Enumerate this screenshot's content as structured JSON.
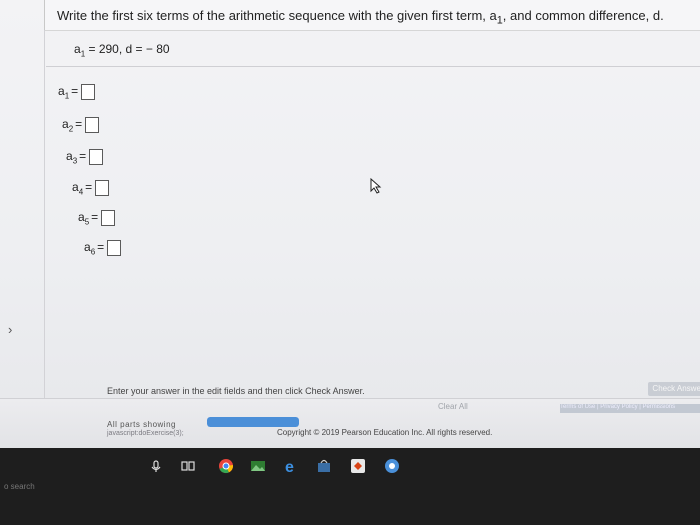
{
  "question": {
    "prefix": "Write the first six terms of the arithmetic sequence with the given first term, a",
    "prefix_sub": "1",
    "suffix": ", and common difference, d."
  },
  "given": {
    "var": "a",
    "sub": "1",
    "text": " = 290, d = − 80"
  },
  "terms": [
    {
      "var": "a",
      "sub": "1",
      "eq": "=",
      "value": ""
    },
    {
      "var": "a",
      "sub": "2",
      "eq": "=",
      "value": ""
    },
    {
      "var": "a",
      "sub": "3",
      "eq": "=",
      "value": ""
    },
    {
      "var": "a",
      "sub": "4",
      "eq": "=",
      "value": ""
    },
    {
      "var": "a",
      "sub": "5",
      "eq": "=",
      "value": ""
    },
    {
      "var": "a",
      "sub": "6",
      "eq": "=",
      "value": ""
    }
  ],
  "footer": {
    "instructions": "Enter your answer in the edit fields and then click Check Answer.",
    "check_answer": "Check Answer",
    "clear_all": "Clear All",
    "parts_shown": "All parts showing",
    "script_link": "javascript:doExercise(3);",
    "copyright": "Copyright © 2019 Pearson Education Inc. All rights reserved.",
    "links": "Terms of Use | Privacy Policy | Permissions",
    "progress": 1.0
  },
  "taskbar": {
    "search": "o search"
  },
  "colors": {
    "accent": "#4b8fd8",
    "taskbar": "#1e1e1e"
  }
}
